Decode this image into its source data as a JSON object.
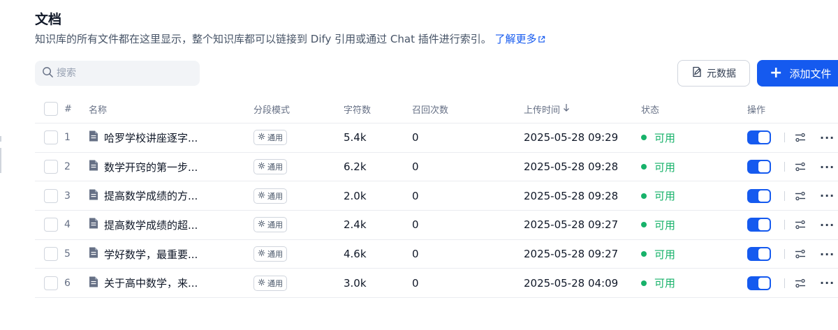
{
  "header": {
    "title": "文档",
    "description": "知识库的所有文件都在这里显示，整个知识库都可以链接到 Dify 引用或通过 Chat 插件进行索引。",
    "learn_more": "了解更多"
  },
  "search": {
    "placeholder": "搜索",
    "value": ""
  },
  "toolbar": {
    "metadata_label": "元数据",
    "add_label": "添加文件"
  },
  "table": {
    "columns": {
      "num": "#",
      "name": "名称",
      "mode": "分段模式",
      "chars": "字符数",
      "recall": "召回次数",
      "upload_time": "上传时间",
      "status": "状态",
      "ops": "操作"
    },
    "rows": [
      {
        "num": "1",
        "name": "哈罗学校讲座逐字...",
        "mode": "通用",
        "chars": "5.4k",
        "recall": "0",
        "time": "2025-05-28 09:29",
        "status": "可用",
        "enabled": true
      },
      {
        "num": "2",
        "name": "数学开窍的第一步...",
        "mode": "通用",
        "chars": "6.2k",
        "recall": "0",
        "time": "2025-05-28 09:28",
        "status": "可用",
        "enabled": true
      },
      {
        "num": "3",
        "name": "提高数学成绩的方...",
        "mode": "通用",
        "chars": "2.0k",
        "recall": "0",
        "time": "2025-05-28 09:28",
        "status": "可用",
        "enabled": true
      },
      {
        "num": "4",
        "name": "提高数学成绩的超...",
        "mode": "通用",
        "chars": "2.4k",
        "recall": "0",
        "time": "2025-05-28 09:27",
        "status": "可用",
        "enabled": true
      },
      {
        "num": "5",
        "name": "学好数学，最重要...",
        "mode": "通用",
        "chars": "4.6k",
        "recall": "0",
        "time": "2025-05-28 09:27",
        "status": "可用",
        "enabled": true
      },
      {
        "num": "6",
        "name": "关于高中数学，来...",
        "mode": "通用",
        "chars": "3.0k",
        "recall": "0",
        "time": "2025-05-28 04:09",
        "status": "可用",
        "enabled": true
      }
    ]
  },
  "icons": {
    "search": "search-icon",
    "external": "external-link-icon",
    "metadata": "edit-document-icon",
    "add": "plus-icon",
    "document": "document-icon",
    "mode": "gear-icon",
    "settings": "sliders-icon",
    "more": "more-horizontal-icon"
  },
  "colors": {
    "accent": "#155aef",
    "status_ok": "#17b26a",
    "text_primary": "#101828",
    "text_secondary": "#667085"
  }
}
